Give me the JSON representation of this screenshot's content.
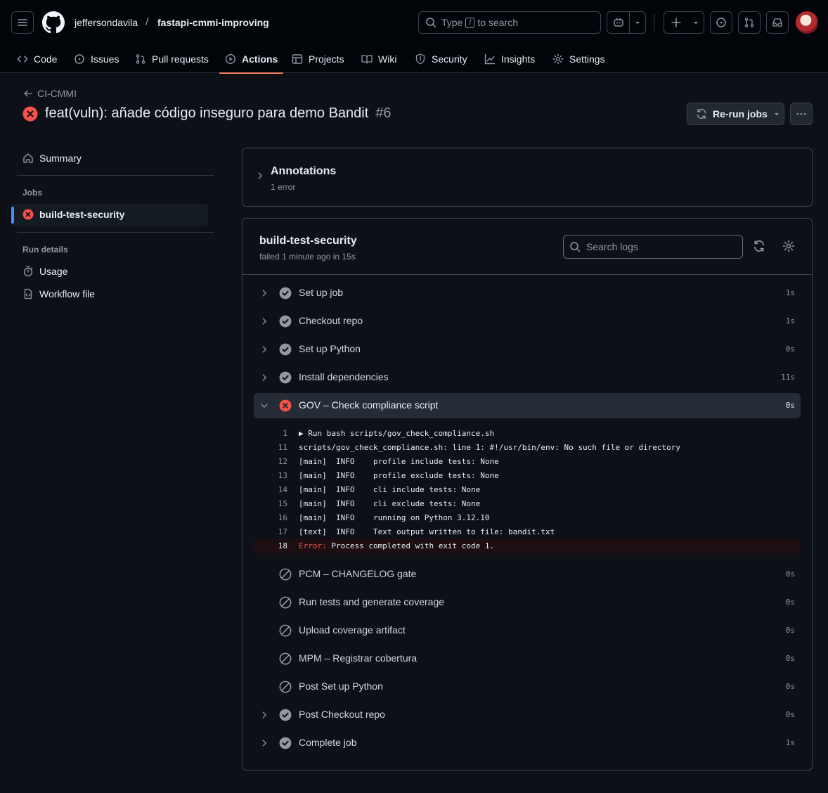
{
  "header": {
    "owner": "jeffersondavila",
    "repo": "fastapi-cmmi-improving",
    "search_type": "Type",
    "search_key": "/",
    "search_suffix": "to search"
  },
  "nav": {
    "tabs": [
      {
        "label": "Code",
        "icon": "code-icon"
      },
      {
        "label": "Issues",
        "icon": "issue-icon"
      },
      {
        "label": "Pull requests",
        "icon": "pull-request-icon"
      },
      {
        "label": "Actions",
        "icon": "play-icon",
        "active": true
      },
      {
        "label": "Projects",
        "icon": "table-icon"
      },
      {
        "label": "Wiki",
        "icon": "book-icon"
      },
      {
        "label": "Security",
        "icon": "shield-icon"
      },
      {
        "label": "Insights",
        "icon": "graph-icon"
      },
      {
        "label": "Settings",
        "icon": "gear-icon"
      }
    ]
  },
  "run": {
    "back_label": "CI-CMMI",
    "title": "feat(vuln): añade código inseguro para demo Bandit",
    "number": "#6",
    "rerun_label": "Re-run jobs"
  },
  "sidebar": {
    "summary": "Summary",
    "jobs_heading": "Jobs",
    "job_name": "build-test-security",
    "run_details_heading": "Run details",
    "usage": "Usage",
    "workflow_file": "Workflow file"
  },
  "annotations": {
    "title": "Annotations",
    "subtitle": "1 error"
  },
  "job": {
    "name": "build-test-security",
    "status": "failed 1 minute ago in 15s",
    "search_placeholder": "Search logs",
    "steps": [
      {
        "name": "Set up job",
        "duration": "1s",
        "status": "success"
      },
      {
        "name": "Checkout repo",
        "duration": "1s",
        "status": "success"
      },
      {
        "name": "Set up Python",
        "duration": "0s",
        "status": "success"
      },
      {
        "name": "Install dependencies",
        "duration": "11s",
        "status": "success"
      },
      {
        "name": "GOV – Check compliance script",
        "duration": "0s",
        "status": "failure",
        "expanded": true
      },
      {
        "name": "PCM – CHANGELOG gate",
        "duration": "0s",
        "status": "skipped"
      },
      {
        "name": "Run tests and generate coverage",
        "duration": "0s",
        "status": "skipped"
      },
      {
        "name": "Upload coverage artifact",
        "duration": "0s",
        "status": "skipped"
      },
      {
        "name": "MPM – Registrar cobertura",
        "duration": "0s",
        "status": "skipped"
      },
      {
        "name": "Post Set up Python",
        "duration": "0s",
        "status": "skipped"
      },
      {
        "name": "Post Checkout repo",
        "duration": "0s",
        "status": "success"
      },
      {
        "name": "Complete job",
        "duration": "1s",
        "status": "success"
      }
    ],
    "log": [
      {
        "n": "1",
        "text": "▶ Run bash scripts/gov_check_compliance.sh"
      },
      {
        "n": "11",
        "text": "scripts/gov_check_compliance.sh: line 1: #!/usr/bin/env: No such file or directory"
      },
      {
        "n": "12",
        "text": "[main]  INFO    profile include tests: None"
      },
      {
        "n": "13",
        "text": "[main]  INFO    profile exclude tests: None"
      },
      {
        "n": "14",
        "text": "[main]  INFO    cli include tests: None"
      },
      {
        "n": "15",
        "text": "[main]  INFO    cli exclude tests: None"
      },
      {
        "n": "16",
        "text": "[main]  INFO    running on Python 3.12.10"
      },
      {
        "n": "17",
        "text": "[text]  INFO    Text output written to file: bandit.txt"
      },
      {
        "n": "18",
        "error_label": "Error:",
        "text": " Process completed with exit code 1."
      }
    ]
  }
}
